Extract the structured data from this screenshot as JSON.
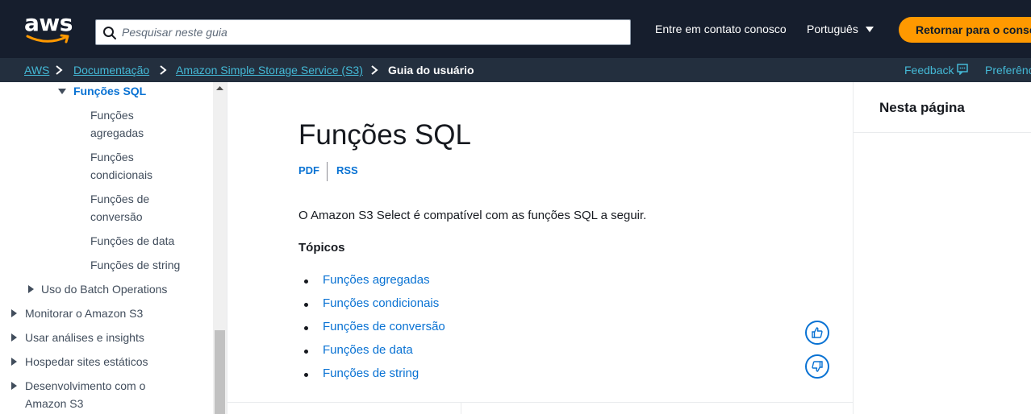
{
  "header": {
    "logo_text": "aws",
    "search_placeholder": "Pesquisar neste guia",
    "contact_link": "Entre em contato conosco",
    "language": "Português",
    "return_button": "Retornar para o console"
  },
  "breadcrumb": {
    "items": [
      "AWS",
      "Documentação",
      "Amazon Simple Storage Service (S3)"
    ],
    "current": "Guia do usuário",
    "feedback": "Feedback",
    "preferences": "Preferências"
  },
  "sidebar": {
    "active": "Funções SQL",
    "children": [
      {
        "line1": "Funções",
        "line2": "agregadas"
      },
      {
        "line1": "Funções",
        "line2": "condicionais"
      },
      {
        "line1": "Funções de",
        "line2": "conversão"
      },
      {
        "line1": "Funções de data",
        "line2": ""
      },
      {
        "line1": "Funções de string",
        "line2": ""
      }
    ],
    "batch": "Uso do Batch Operations",
    "items": [
      {
        "line1": "Monitorar o Amazon S3",
        "line2": ""
      },
      {
        "line1": "Usar análises e insights",
        "line2": ""
      },
      {
        "line1": "Hospedar sites estáticos",
        "line2": ""
      },
      {
        "line1": "Desenvolvimento com o",
        "line2": "Amazon S3"
      }
    ]
  },
  "main": {
    "title": "Funções SQL",
    "pdf": "PDF",
    "rss": "RSS",
    "intro": "O Amazon S3 Select é compatível com as funções SQL a seguir.",
    "topics_heading": "Tópicos",
    "topics": [
      "Funções agregadas",
      "Funções condicionais",
      "Funções de conversão",
      "Funções de data",
      "Funções de string"
    ]
  },
  "right_rail": {
    "title": "Nesta página"
  },
  "colors": {
    "header_bg": "#161e2d",
    "crumb_bg": "#232f3e",
    "link": "#0972d3",
    "crumb_link": "#44b9d6",
    "accent": "#ff9900"
  }
}
